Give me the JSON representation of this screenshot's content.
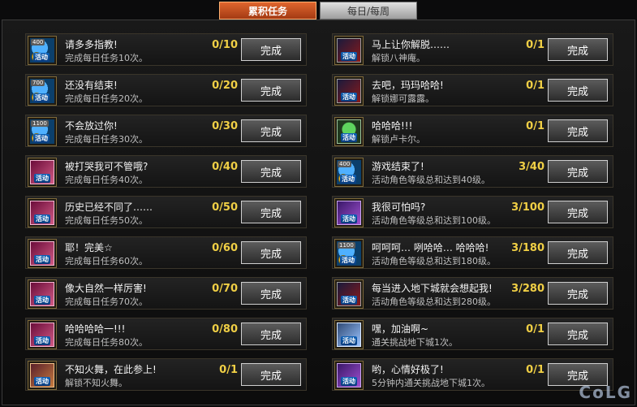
{
  "tabs": [
    {
      "label": "累积任务",
      "active": true
    },
    {
      "label": "每日/每周",
      "active": false
    }
  ],
  "left_tasks": [
    {
      "title": "请多多指教!",
      "desc": "完成每日任务10次。",
      "progress": "0/10",
      "button": "完成",
      "icon": "coin",
      "badge": "400",
      "tag": "活动"
    },
    {
      "title": "还没有结束!",
      "desc": "完成每日任务20次。",
      "progress": "0/20",
      "button": "完成",
      "icon": "coin",
      "badge": "700",
      "tag": "活动"
    },
    {
      "title": "不会放过你!",
      "desc": "完成每日任务30次。",
      "progress": "0/30",
      "button": "完成",
      "icon": "coin",
      "badge": "1100",
      "tag": "活动"
    },
    {
      "title": "被打哭我可不管哦?",
      "desc": "完成每日任务40次。",
      "progress": "0/40",
      "button": "完成",
      "icon": "card",
      "badge": "",
      "tag": "活动"
    },
    {
      "title": "历史已经不同了……",
      "desc": "完成每日任务50次。",
      "progress": "0/50",
      "button": "完成",
      "icon": "card",
      "badge": "",
      "tag": "活动"
    },
    {
      "title": "耶！完美☆",
      "desc": "完成每日任务60次。",
      "progress": "0/60",
      "button": "完成",
      "icon": "card",
      "badge": "",
      "tag": "活动"
    },
    {
      "title": "像大自然一样厉害!",
      "desc": "完成每日任务70次。",
      "progress": "0/70",
      "button": "完成",
      "icon": "card",
      "badge": "",
      "tag": "活动"
    },
    {
      "title": "哈哈哈哈一!!!",
      "desc": "完成每日任务80次。",
      "progress": "0/80",
      "button": "完成",
      "icon": "card",
      "badge": "",
      "tag": "活动"
    },
    {
      "title": "不知火舞，在此参上!",
      "desc": "解锁不知火舞。",
      "progress": "0/1",
      "button": "完成",
      "icon": "hero",
      "badge": "",
      "tag": "活动"
    }
  ],
  "right_tasks": [
    {
      "title": "马上让你解脱……",
      "desc": "解锁八神庵。",
      "progress": "0/1",
      "button": "完成",
      "icon": "dark",
      "badge": "",
      "tag": "活动"
    },
    {
      "title": "去吧，玛玛哈哈!",
      "desc": "解锁娜可露露。",
      "progress": "0/1",
      "button": "完成",
      "icon": "dark",
      "badge": "",
      "tag": "活动"
    },
    {
      "title": "哈哈哈!!!",
      "desc": "解锁卢卡尔。",
      "progress": "0/1",
      "button": "完成",
      "icon": "green",
      "badge": "",
      "tag": "活动"
    },
    {
      "title": "游戏结束了!",
      "desc": "活动角色等级总和达到40级。",
      "progress": "3/40",
      "button": "完成",
      "icon": "coin",
      "badge": "400",
      "tag": "活动"
    },
    {
      "title": "我很可怕吗?",
      "desc": "活动角色等级总和达到100级。",
      "progress": "3/100",
      "button": "完成",
      "icon": "purple",
      "badge": "",
      "tag": "活动"
    },
    {
      "title": "呵呵呵… 咧哈哈… 哈哈哈!",
      "desc": "活动角色等级总和达到180级。",
      "progress": "3/180",
      "button": "完成",
      "icon": "coin",
      "badge": "1100",
      "tag": "活动"
    },
    {
      "title": "每当进入地下城就会想起我!",
      "desc": "活动角色等级总和达到280级。",
      "progress": "3/280",
      "button": "完成",
      "icon": "dark",
      "badge": "",
      "tag": "活动"
    },
    {
      "title": "嘿，加油啊~",
      "desc": "通关挑战地下城1次。",
      "progress": "0/1",
      "button": "完成",
      "icon": "blue",
      "badge": "",
      "tag": "活动"
    },
    {
      "title": "哟，心情好极了!",
      "desc": "5分钟内通关挑战地下城1次。",
      "progress": "0/1",
      "button": "完成",
      "icon": "purple",
      "badge": "",
      "tag": "活动"
    }
  ],
  "watermark": "CoLG"
}
